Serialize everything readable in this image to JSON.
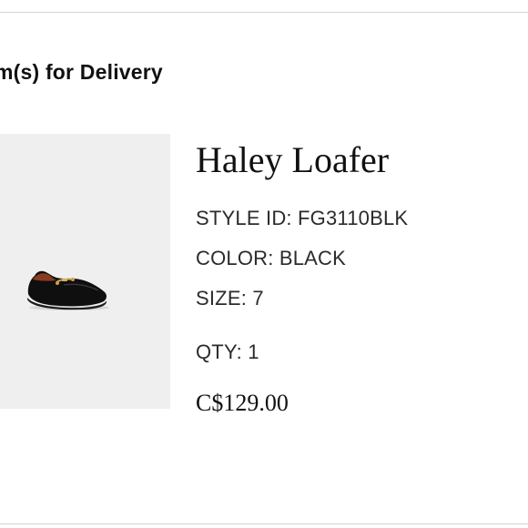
{
  "section": {
    "heading": "m(s) for Delivery"
  },
  "item": {
    "name": "Haley Loafer",
    "style_id": "STYLE ID: FG3110BLK",
    "color": "COLOR: BLACK",
    "size": "SIZE: 7",
    "qty": "QTY: 1",
    "price": "C$129.00",
    "image_icon": "loafer-shoe-image"
  },
  "colors": {
    "image_background": "#efefef",
    "text": "#111111",
    "rule": "#d4d4d4"
  }
}
